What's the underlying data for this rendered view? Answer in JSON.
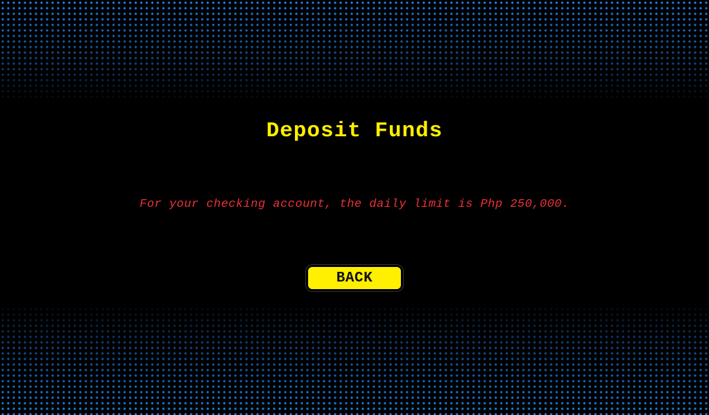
{
  "page": {
    "title": "Deposit Funds",
    "message": "For your checking account, the daily limit is Php 250,000."
  },
  "actions": {
    "back_label": "BACK"
  },
  "colors": {
    "background": "#000000",
    "title": "#ffef00",
    "message": "#f0303a",
    "button_bg": "#ffef00",
    "dot_pattern": "#1e7fe6"
  }
}
